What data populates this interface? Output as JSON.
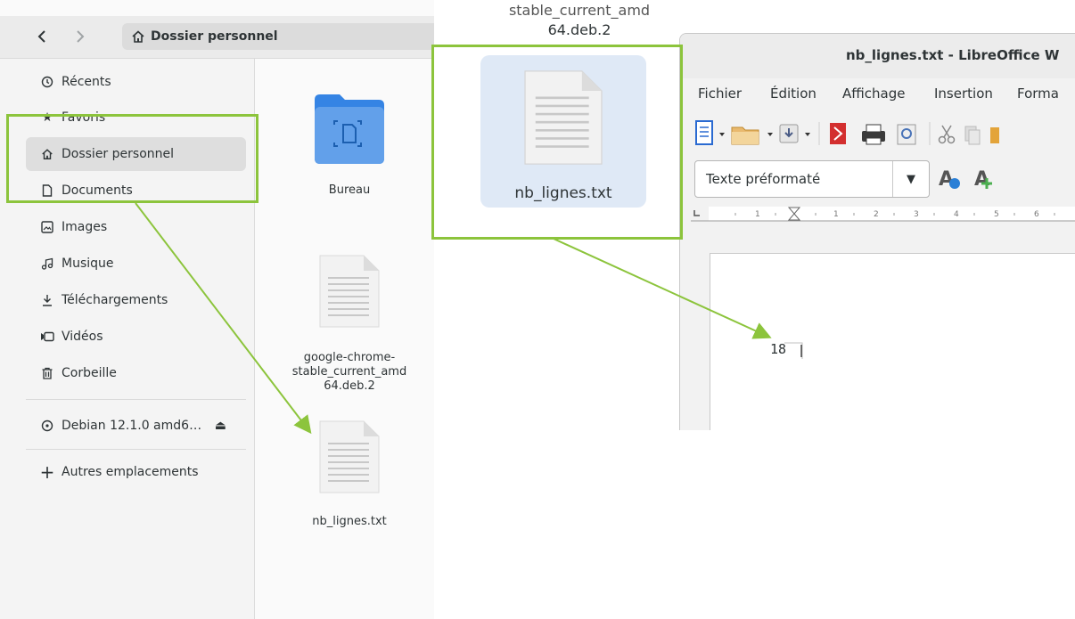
{
  "file_manager": {
    "nav": {
      "back_icon": "chevron-left-icon",
      "forward_icon": "chevron-right-icon"
    },
    "path_bar": {
      "label": "Dossier personnel",
      "icon": "home-icon"
    },
    "sidebar": {
      "items": [
        {
          "label": "Récents",
          "icon": "clock-icon"
        },
        {
          "label": "Favoris",
          "icon": "star-icon"
        },
        {
          "label": "Dossier personnel",
          "icon": "home-icon",
          "active": true
        },
        {
          "label": "Documents",
          "icon": "document-icon"
        },
        {
          "label": "Images",
          "icon": "image-icon"
        },
        {
          "label": "Musique",
          "icon": "music-icon"
        },
        {
          "label": "Téléchargements",
          "icon": "download-icon"
        },
        {
          "label": "Vidéos",
          "icon": "video-icon"
        },
        {
          "label": "Corbeille",
          "icon": "trash-icon"
        }
      ],
      "drive": {
        "label": "Debian 12.1.0 amd6…",
        "icon": "disc-icon",
        "eject_icon": "eject-icon"
      },
      "other_locations": {
        "label": "Autres emplacements",
        "icon": "plus-icon"
      }
    },
    "files": [
      {
        "label": "Bureau",
        "type": "folder"
      },
      {
        "label": "google-chrome-\nstable_current_amd\n64.deb.2",
        "type": "document"
      },
      {
        "label": "nb_lignes.txt",
        "type": "document"
      }
    ]
  },
  "dragged": {
    "partial_label_top": "stable_current_amd",
    "partial_label_bottom": "64.deb.2",
    "file_label": "nb_lignes.txt"
  },
  "libreoffice": {
    "title": "nb_lignes.txt - LibreOffice W",
    "menu": [
      "Fichier",
      "Édition",
      "Affichage",
      "Insertion",
      "Forma"
    ],
    "paragraph_style": "Texte préformaté",
    "ruler_numbers": [
      "1",
      "1",
      "2",
      "3",
      "4",
      "5",
      "6"
    ],
    "document_text": "18"
  },
  "colors": {
    "highlight": "#8cc43c",
    "folder_blue": "#4a90d9",
    "selection": "#dfe9f6"
  }
}
